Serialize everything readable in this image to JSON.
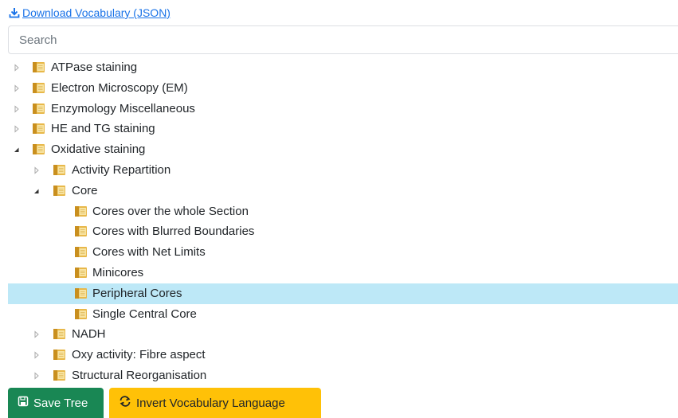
{
  "download": {
    "label": "Download Vocabulary (JSON)"
  },
  "search": {
    "placeholder": "Search",
    "value": ""
  },
  "tree": [
    {
      "label": "ATPase staining",
      "depth": 0,
      "expander": "collapsed"
    },
    {
      "label": "Electron Microscopy (EM)",
      "depth": 0,
      "expander": "collapsed"
    },
    {
      "label": "Enzymology Miscellaneous",
      "depth": 0,
      "expander": "collapsed"
    },
    {
      "label": "HE and TG staining",
      "depth": 0,
      "expander": "collapsed"
    },
    {
      "label": "Oxidative staining",
      "depth": 0,
      "expander": "expanded"
    },
    {
      "label": "Activity Repartition",
      "depth": 1,
      "expander": "collapsed"
    },
    {
      "label": "Core",
      "depth": 1,
      "expander": "expanded"
    },
    {
      "label": "Cores over the whole Section",
      "depth": 2,
      "expander": "none"
    },
    {
      "label": "Cores with Blurred Boundaries",
      "depth": 2,
      "expander": "none"
    },
    {
      "label": "Cores with Net Limits",
      "depth": 2,
      "expander": "none"
    },
    {
      "label": "Minicores",
      "depth": 2,
      "expander": "none"
    },
    {
      "label": "Peripheral Cores",
      "depth": 2,
      "expander": "none",
      "selected": true
    },
    {
      "label": "Single Central Core",
      "depth": 2,
      "expander": "none"
    },
    {
      "label": "NADH",
      "depth": 1,
      "expander": "collapsed"
    },
    {
      "label": "Oxy activity: Fibre aspect",
      "depth": 1,
      "expander": "collapsed"
    },
    {
      "label": "Structural Reorganisation",
      "depth": 1,
      "expander": "collapsed"
    }
  ],
  "buttons": {
    "save_label": "Save Tree",
    "invert_label": "Invert Vocabulary Language"
  },
  "colors": {
    "link": "#1a73e8",
    "selected_row": "#bde8f7",
    "save_button": "#198754",
    "invert_button": "#ffc107",
    "folder": "#e8b84a"
  },
  "icons": {
    "download": "download-icon",
    "collapsed": "caret-right-icon",
    "expanded": "caret-down-icon",
    "node": "folder-icon",
    "save": "floppy-disk-icon",
    "invert": "swap-arrows-icon"
  }
}
